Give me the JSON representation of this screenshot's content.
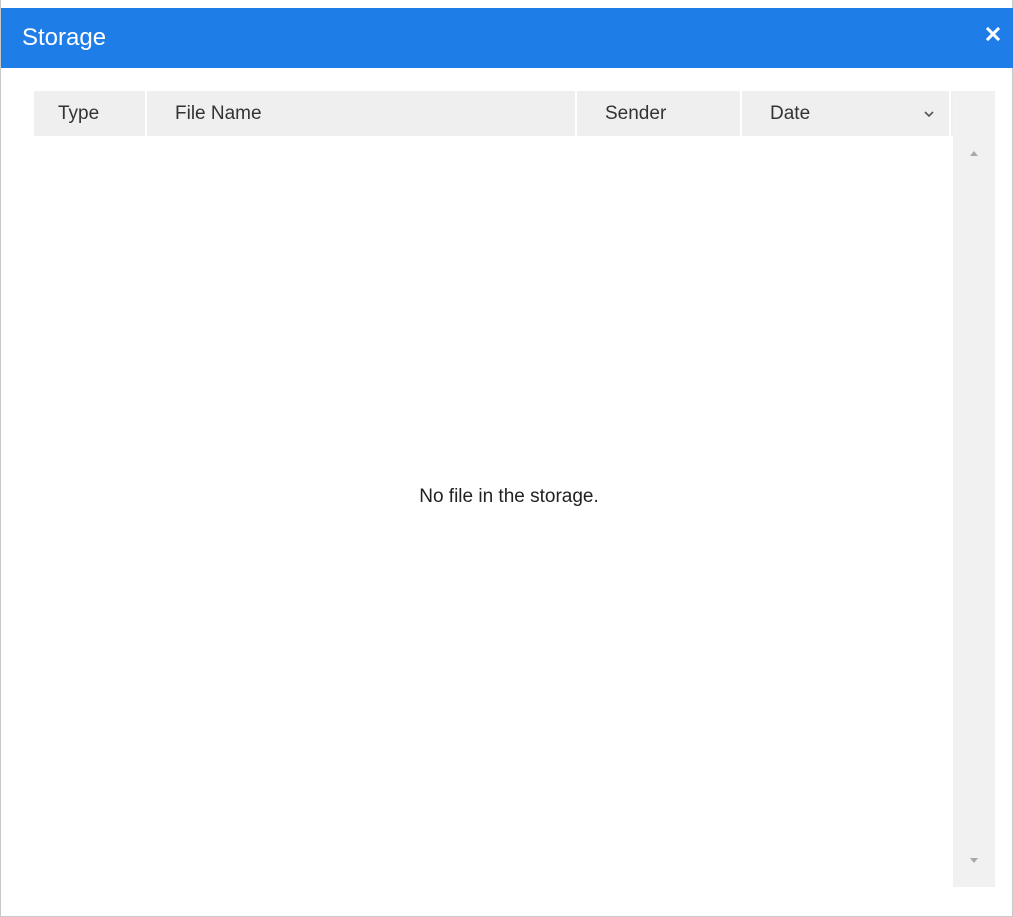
{
  "window": {
    "title": "Storage",
    "close_label": "✕"
  },
  "table": {
    "columns": [
      {
        "label": "Type"
      },
      {
        "label": "File Name"
      },
      {
        "label": "Sender"
      },
      {
        "label": "Date"
      }
    ],
    "sort_icon": "chevron-down-icon",
    "empty_message": "No file in the storage."
  },
  "colors": {
    "titlebar": "#1f7de8",
    "header_bg": "#efefef",
    "scrollbar_bg": "#f1f1f1"
  }
}
